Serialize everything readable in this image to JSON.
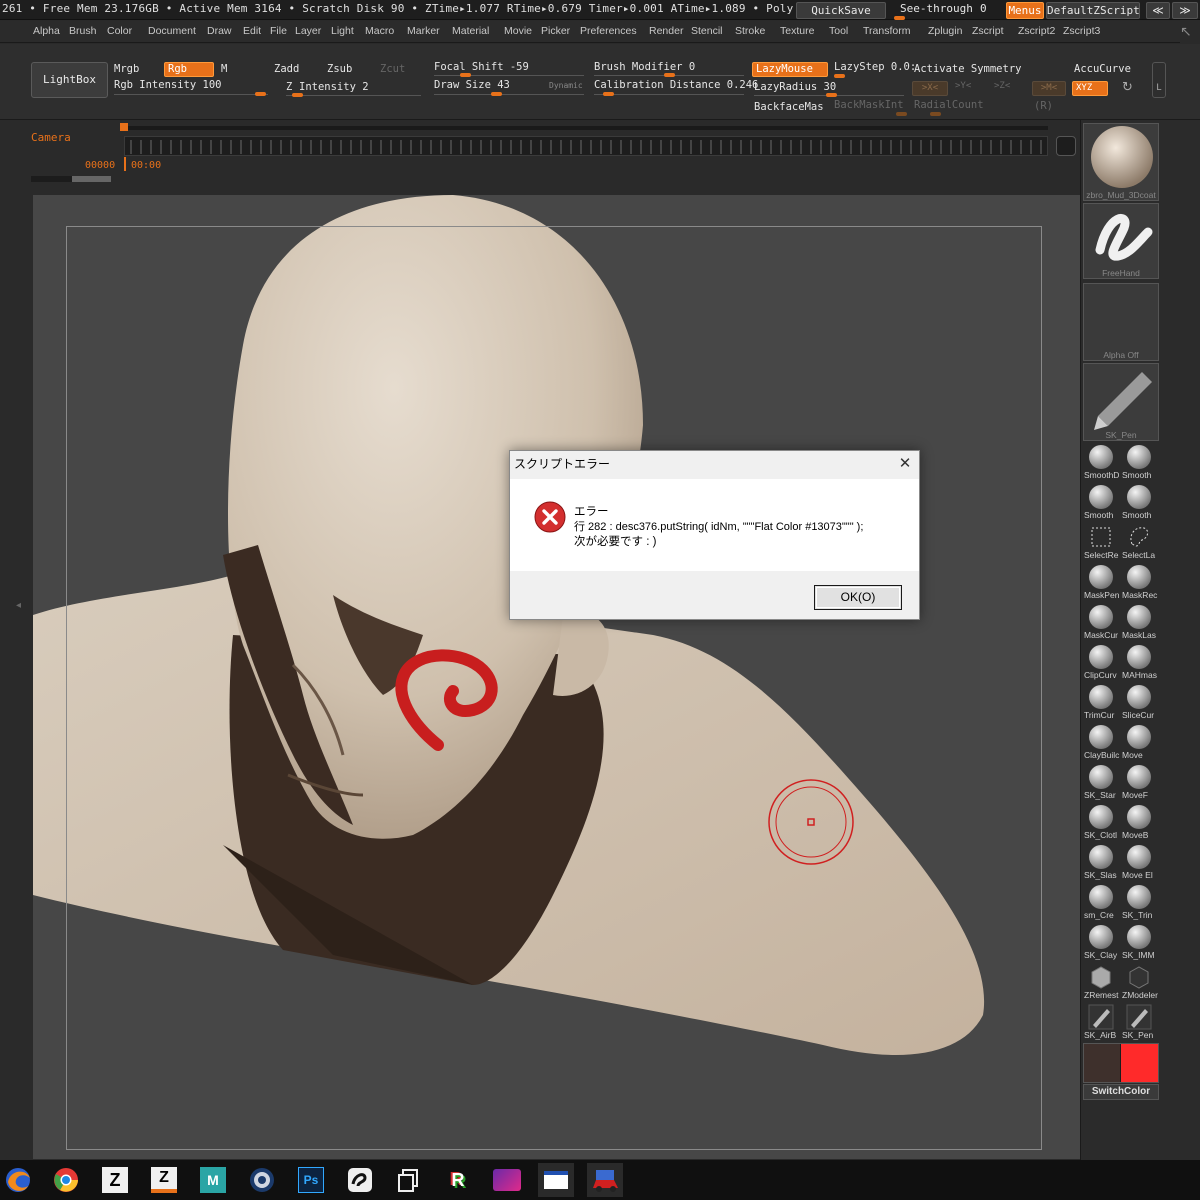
{
  "statusbar": {
    "text": "261  • Free Mem 23.176GB • Active Mem 3164 • Scratch Disk 90 •  ZTime▸1.077 RTime▸0.679 Timer▸0.001 ATime▸1.089 • Poly",
    "quicksave": "QuickSave",
    "seethrough_label": "See-through",
    "seethrough_value": "0",
    "menus": "Menus",
    "default_zscript": "DefaultZScript"
  },
  "menubar": [
    "Alpha",
    "Brush",
    "Color",
    "Document",
    "Draw",
    "Edit",
    "File",
    "Layer",
    "Light",
    "Macro",
    "Marker",
    "Material",
    "Movie",
    "Picker",
    "Preferences",
    "Render",
    "Stencil",
    "Stroke",
    "Texture",
    "Tool",
    "Transform",
    "Zplugin",
    "Zscript",
    "Zscript2",
    "Zscript3"
  ],
  "shelf": {
    "lightbox": "LightBox",
    "mrgb": "Mrgb",
    "rgb": "Rgb",
    "m": "M",
    "zadd": "Zadd",
    "zsub": "Zsub",
    "zcut": "Zcut",
    "rgb_intensity": "Rgb  Intensity 100",
    "z": "Z",
    "z_intensity": "Intensity 2",
    "focal_shift": "Focal Shift -59",
    "draw_size": "Draw Size 43",
    "dynamic": "Dynamic",
    "brush_modifier": "Brush Modifier 0",
    "calibration_distance": "Calibration Distance 0.246",
    "lazymouse": "LazyMouse",
    "lazystep": "LazyStep 0.0:",
    "lazyradius": "LazyRadius 30",
    "backfacemask": "BackfaceMas",
    "backmaskint": "BackMaskInt",
    "activate_symmetry": "Activate Symmetry",
    "x_axis": ">X<",
    "y_axis": ">Y<",
    "z_axis": ">Z<",
    "m_sym": ">M<",
    "radialcount": "RadialCount",
    "r": "(R)",
    "accucurve": "AccuCurve",
    "xyz": "XYZ",
    "l": "L"
  },
  "timeline": {
    "camera": "Camera",
    "counter": "00000",
    "time": "00:00"
  },
  "tray": {
    "material_label": "zbro_Mud_3Dcoat",
    "stroke_label": "FreeHand",
    "alpha_label": "Alpha  Off",
    "brush_label": "SK_Pen",
    "brushes": [
      [
        "SmoothD",
        "Smooth"
      ],
      [
        "Smooth",
        "Smooth"
      ],
      [
        "SelectRe",
        "SelectLa"
      ],
      [
        "MaskPen",
        "MaskRec"
      ],
      [
        "MaskCur",
        "MaskLas"
      ],
      [
        "ClipCurv",
        "MAHmas"
      ],
      [
        "TrimCur",
        "SliceCur"
      ],
      [
        "ClayBuilc",
        "Move"
      ],
      [
        "SK_Star",
        "MoveF"
      ],
      [
        "SK_Clotl",
        "MoveB"
      ],
      [
        "SK_Slas",
        "Move  El"
      ],
      [
        "sm_Cre",
        "SK_Trin"
      ],
      [
        "SK_Clay",
        "SK_IMM"
      ],
      [
        "ZRemest",
        "ZModeler"
      ],
      [
        "SK_AirB",
        "SK_Pen"
      ]
    ],
    "switchcolor": "SwitchColor",
    "colors": {
      "main": "#3e302c",
      "secondary": "#ff2a2a"
    }
  },
  "dialog": {
    "title": "スクリプトエラー",
    "close": "✕",
    "heading": "エラー",
    "line1": "行 282 : desc376.putString( idNm, \"\"\"Flat Color #13073\"\"\" );",
    "line2": "次が必要です : )",
    "ok": "OK(O)"
  },
  "taskbar": {
    "items": [
      "firefox-icon",
      "chrome-icon",
      "zbrush-icon",
      "zbrush-alt-icon",
      "marvelous-icon",
      "cinema4d-icon",
      "photoshop-icon",
      "app-curve-icon",
      "copy-windows-icon",
      "r-app-icon",
      "game-app-icon",
      "window-app-icon",
      "car-app-icon"
    ],
    "ps_text": "Ps",
    "r_text": "R"
  },
  "accent": "#e8711a"
}
